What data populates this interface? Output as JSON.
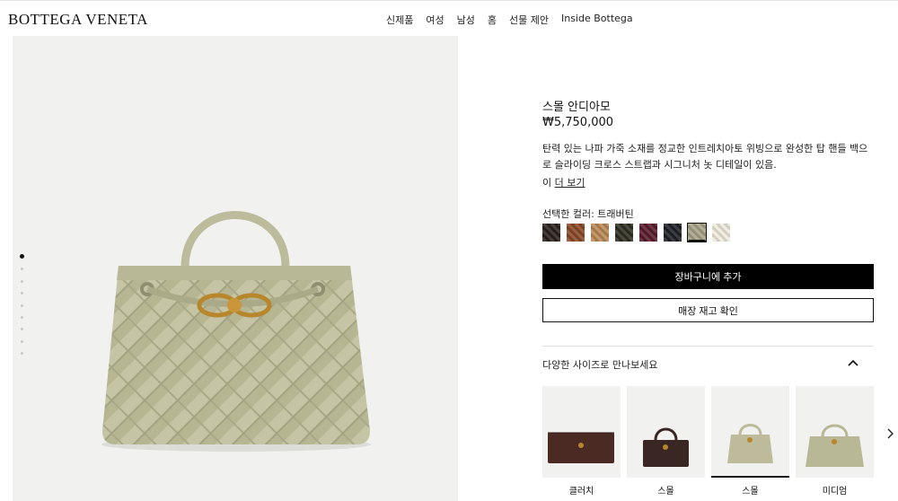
{
  "header": {
    "logo": "BOTTEGA VENETA",
    "nav": [
      "신제품",
      "여성",
      "남성",
      "홈",
      "선물 제안",
      "Inside Bottega"
    ]
  },
  "gallery": {
    "image_count": 9,
    "active_index": 0,
    "bag_color": "#c7c6a7"
  },
  "product": {
    "title": "스몰 안디아모",
    "price": "₩5,750,000",
    "description": "탄력 있는 나파 가죽 소재를 정교한 인트레치아토 위빙으로 완성한 탑 핸들 백으로 슬라이딩 크로스 스트랩과 시그니처 놋 디테일이 있음.",
    "more_prefix": "이",
    "more_link": "더 보기",
    "color_label": "선택한 컬러: 트래버틴",
    "swatches": [
      {
        "name": "black-brown",
        "color": "#2a211c"
      },
      {
        "name": "brown",
        "color": "#8a4a26"
      },
      {
        "name": "caramel",
        "color": "#b98a57"
      },
      {
        "name": "dark-olive",
        "color": "#2f2f22"
      },
      {
        "name": "burgundy",
        "color": "#5a1b2b"
      },
      {
        "name": "navy-black",
        "color": "#1f2128"
      },
      {
        "name": "travertine",
        "color": "#a7a286",
        "selected": true
      },
      {
        "name": "cream",
        "color": "#efebdc"
      }
    ],
    "add_to_cart": "장바구니에 추가",
    "check_store": "매장 재고 확인"
  },
  "sizes": {
    "title": "다양한 사이즈로 만나보세요",
    "items": [
      {
        "label": "클러치",
        "color": "#4a2a22",
        "shape": "clutch"
      },
      {
        "label": "스몰",
        "color": "#3a2622",
        "shape": "east-west"
      },
      {
        "label": "스몰",
        "color": "#bdbb9c",
        "shape": "small",
        "selected": true
      },
      {
        "label": "미디엄",
        "color": "#b8b796",
        "shape": "medium"
      }
    ]
  }
}
